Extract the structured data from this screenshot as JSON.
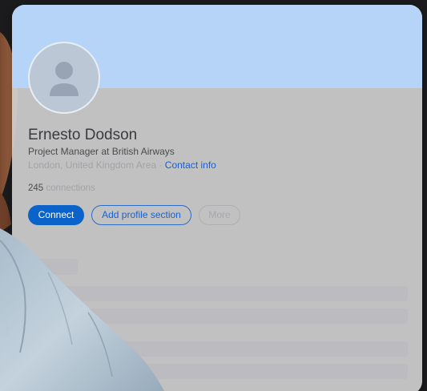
{
  "profile": {
    "name": "Ernesto Dodson",
    "headline": "Project Manager at British Airways",
    "location": "London, United Kingdom Area",
    "separator": " · ",
    "contact_label": "Contact info",
    "connections_count": "245",
    "connections_label": " connections"
  },
  "actions": {
    "connect_label": "Connect",
    "add_section_label": "Add profile section",
    "more_label": "More"
  },
  "colors": {
    "banner": "#b5d4f8",
    "primary": "#0a63c9",
    "link": "#1a5fd0"
  },
  "icons": {
    "avatar": "person-silhouette-icon"
  }
}
